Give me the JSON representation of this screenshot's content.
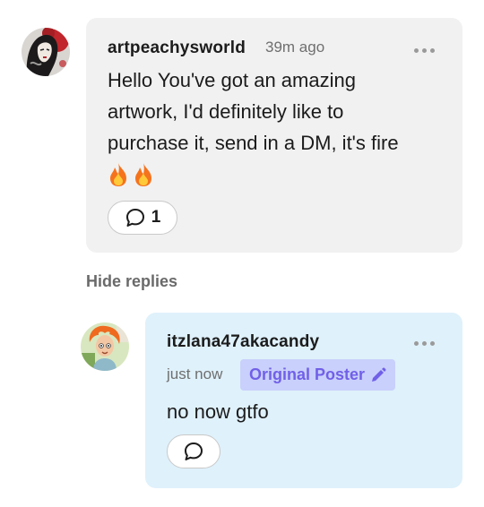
{
  "comment": {
    "username": "artpeachysworld",
    "timestamp": "39m ago",
    "body_line1": "Hello You've got an amazing",
    "body_line2": "artwork, I'd definitely like to",
    "body_line3": "purchase it, send in a DM, it's fire",
    "body_emoji": "🔥🔥",
    "reply_count": "1",
    "avatar_icon": "woman-portrait-icon"
  },
  "thread": {
    "hide_replies_label": "Hide replies"
  },
  "reply": {
    "username": "itzlana47akacandy",
    "timestamp": "just now",
    "badge_label": "Original Poster",
    "badge_icon": "pencil-icon",
    "body": "no now gtfo",
    "avatar_icon": "orange-hair-cartoon-icon"
  },
  "colors": {
    "comment_bg": "#f1f1f1",
    "reply_bg": "#dff1fb",
    "badge_bg": "#c9d0fb",
    "badge_text": "#7160e8"
  }
}
